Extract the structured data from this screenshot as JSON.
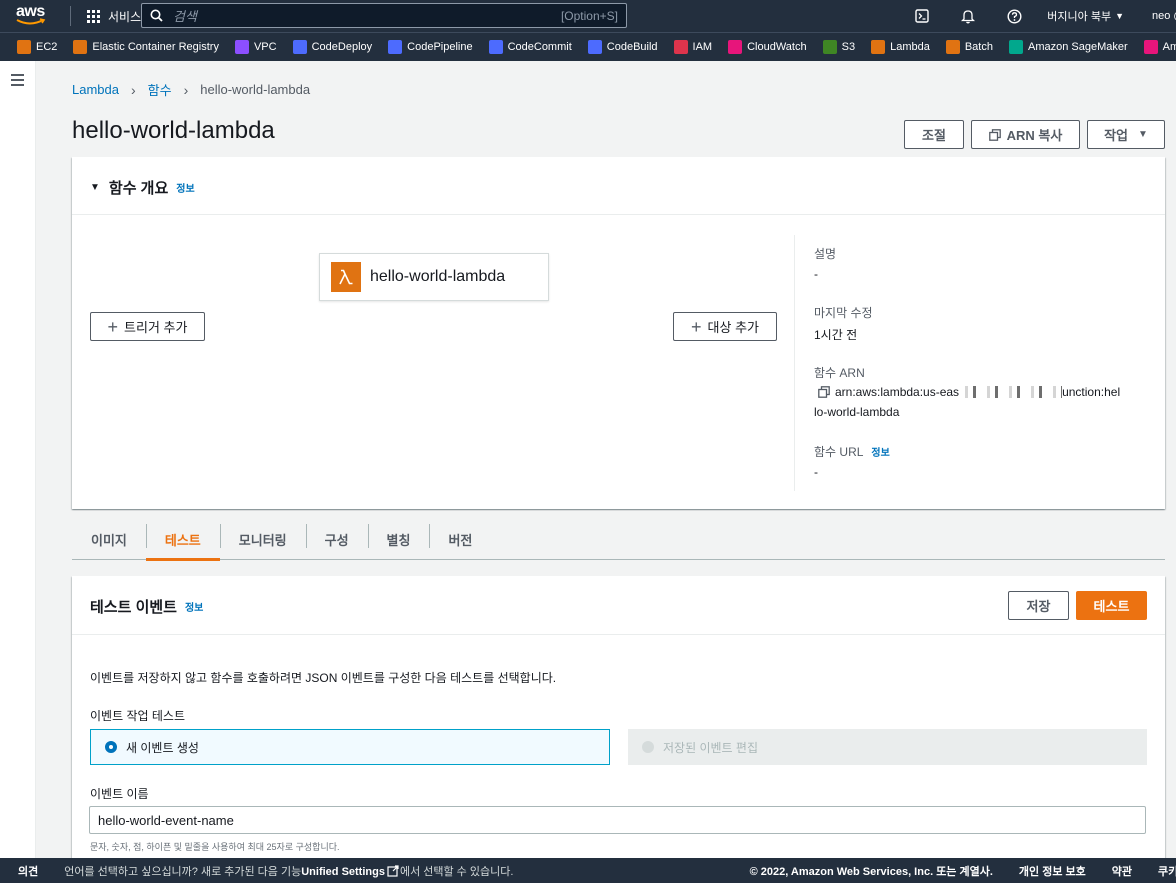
{
  "topnav": {
    "services_label": "서비스",
    "search_placeholder": "검색",
    "search_shortcut": "[Option+S]",
    "region": "버지니아 북부",
    "user": "neo @"
  },
  "favorites": [
    {
      "label": "EC2",
      "color": "#e07312"
    },
    {
      "label": "Elastic Container Registry",
      "color": "#e07312"
    },
    {
      "label": "VPC",
      "color": "#8c4fff"
    },
    {
      "label": "CodeDeploy",
      "color": "#4d6bfe"
    },
    {
      "label": "CodePipeline",
      "color": "#4d6bfe"
    },
    {
      "label": "CodeCommit",
      "color": "#4d6bfe"
    },
    {
      "label": "CodeBuild",
      "color": "#4d6bfe"
    },
    {
      "label": "IAM",
      "color": "#dd344c"
    },
    {
      "label": "CloudWatch",
      "color": "#e7157b"
    },
    {
      "label": "S3",
      "color": "#3f8624"
    },
    {
      "label": "Lambda",
      "color": "#e07312"
    },
    {
      "label": "Batch",
      "color": "#e07312"
    },
    {
      "label": "Amazon SageMaker",
      "color": "#01a88d"
    },
    {
      "label": "Amaz",
      "color": "#e7157b"
    }
  ],
  "breadcrumb": {
    "item1": "Lambda",
    "item2": "함수",
    "current": "hello-world-lambda"
  },
  "page_title": "hello-world-lambda",
  "header_buttons": {
    "throttle": "조절",
    "copy_arn": "ARN 복사",
    "actions": "작업"
  },
  "overview": {
    "title": "함수 개요",
    "info": "정보",
    "function_name": "hello-world-lambda",
    "add_trigger": "트리거 추가",
    "add_destination": "대상 추가",
    "description_label": "설명",
    "description_value": "-",
    "last_modified_label": "마지막 수정",
    "last_modified_value": "1시간 전",
    "arn_label": "함수 ARN",
    "arn_line1": "arn:aws:lambda:us-eas",
    "arn_line1_end": "unction:hel",
    "arn_line2": "lo-world-lambda",
    "url_label": "함수 URL",
    "url_info": "정보",
    "url_value": "-"
  },
  "tabs": [
    {
      "label": "이미지",
      "active": false
    },
    {
      "label": "테스트",
      "active": true
    },
    {
      "label": "모니터링",
      "active": false
    },
    {
      "label": "구성",
      "active": false
    },
    {
      "label": "별칭",
      "active": false
    },
    {
      "label": "버전",
      "active": false
    }
  ],
  "test_event": {
    "title": "테스트 이벤트",
    "info": "정보",
    "save": "저장",
    "test": "테스트",
    "description": "이벤트를 저장하지 않고 함수를 호출하려면 JSON 이벤트를 구성한 다음 테스트를 선택합니다.",
    "action_label": "이벤트 작업 테스트",
    "option_new": "새 이벤트 생성",
    "option_edit": "저장된 이벤트 편집",
    "name_label": "이벤트 이름",
    "name_value": "hello-world-event-name",
    "name_hint": "문자, 숫자, 점, 하이픈 및 밑줄을 사용하여 최대 25자로 구성합니다."
  },
  "footer": {
    "feedback": "의견",
    "msg_prefix": "언어를 선택하고 싶으십니까? 새로 추가된 다음 기능",
    "msg_bold": "Unified Settings",
    "msg_suffix": "에서 선택할 수 있습니다.",
    "copyright": "© 2022, Amazon Web Services, Inc. 또는 계열사.",
    "privacy": "개인 정보 보호",
    "terms": "약관",
    "cookies": "쿠키"
  },
  "colors": {
    "nav_bg": "#232f3e",
    "accent": "#ec7211",
    "link": "#0073bb"
  }
}
